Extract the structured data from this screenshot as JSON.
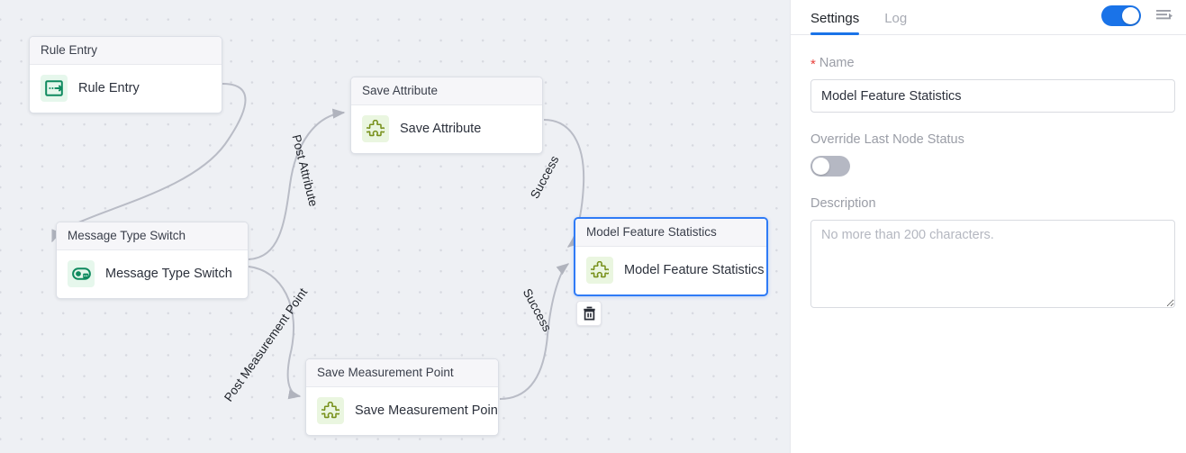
{
  "canvas": {
    "nodes": [
      {
        "id": "rule-entry",
        "title": "Rule Entry",
        "label": "Rule Entry",
        "icon": "rule-entry-icon",
        "selected": false
      },
      {
        "id": "message-type-switch",
        "title": "Message Type Switch",
        "label": "Message Type Switch",
        "icon": "switch-icon",
        "selected": false
      },
      {
        "id": "save-attribute",
        "title": "Save Attribute",
        "label": "Save Attribute",
        "icon": "puzzle-piece-icon",
        "selected": false
      },
      {
        "id": "model-feature-statistics",
        "title": "Model Feature Statistics",
        "label": "Model Feature Statistics",
        "icon": "puzzle-piece-icon",
        "selected": true
      },
      {
        "id": "save-measurement-point",
        "title": "Save Measurement Point",
        "label": "Save Measurement Point",
        "icon": "puzzle-piece-icon",
        "selected": false
      }
    ],
    "edge_labels": [
      {
        "id": "post-attribute",
        "text": "Post Attribute"
      },
      {
        "id": "post-measurement-point",
        "text": "Post Measurement Point"
      },
      {
        "id": "success-top",
        "text": "Success"
      },
      {
        "id": "success-bottom",
        "text": "Success"
      }
    ],
    "delete_button": {
      "icon": "trash-icon",
      "tooltip": ""
    },
    "colors": {
      "background": "#eef0f4",
      "dot": "#d7d9e0",
      "edge": "#b9bcc6",
      "selected_border": "#2f7bf6",
      "icon_teal": "#0f8a5f",
      "icon_olive": "#77901a"
    }
  },
  "panel": {
    "tabs": [
      {
        "id": "settings",
        "label": "Settings",
        "active": true
      },
      {
        "id": "log",
        "label": "Log",
        "active": false
      }
    ],
    "header_toggle": {
      "name": "enable-toggle",
      "state": "on"
    },
    "expand_icon": "expand-panel-icon",
    "form": {
      "name": {
        "label": "Name",
        "required_marker": "*",
        "value": "Model Feature Statistics",
        "placeholder": ""
      },
      "override_last_node_status": {
        "label": "Override Last Node Status",
        "state": "off"
      },
      "description": {
        "label": "Description",
        "value": "",
        "placeholder": "No more than 200 characters."
      }
    },
    "colors": {
      "accent": "#1a73e8",
      "required": "#e8403a"
    }
  }
}
